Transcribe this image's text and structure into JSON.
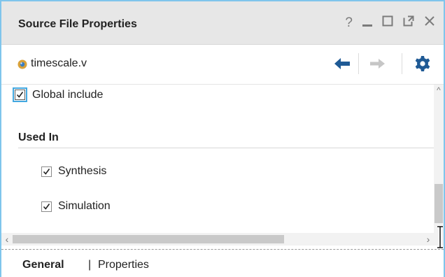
{
  "panel": {
    "title": "Source File Properties",
    "window_icons": [
      "?",
      "_",
      "☐",
      "⧉",
      "✕"
    ]
  },
  "toolbar": {
    "file_name": "timescale.v",
    "back_icon": "arrow-left-icon",
    "forward_icon": "arrow-right-icon",
    "settings_icon": "gear-icon"
  },
  "properties": {
    "global_include": {
      "label": "Global include",
      "checked": true
    },
    "used_in": {
      "heading": "Used In",
      "items": [
        {
          "label": "Synthesis",
          "checked": true
        },
        {
          "label": "Simulation",
          "checked": true
        }
      ]
    }
  },
  "tabs": {
    "items": [
      {
        "label": "General",
        "active": true
      },
      {
        "label": "Properties",
        "active": false
      }
    ],
    "separator": "|"
  },
  "colors": {
    "border": "#7fc5ec",
    "titlebar": "#e7e7e7",
    "nav_active": "#1f5a95",
    "nav_inactive": "#c6c6c6"
  }
}
